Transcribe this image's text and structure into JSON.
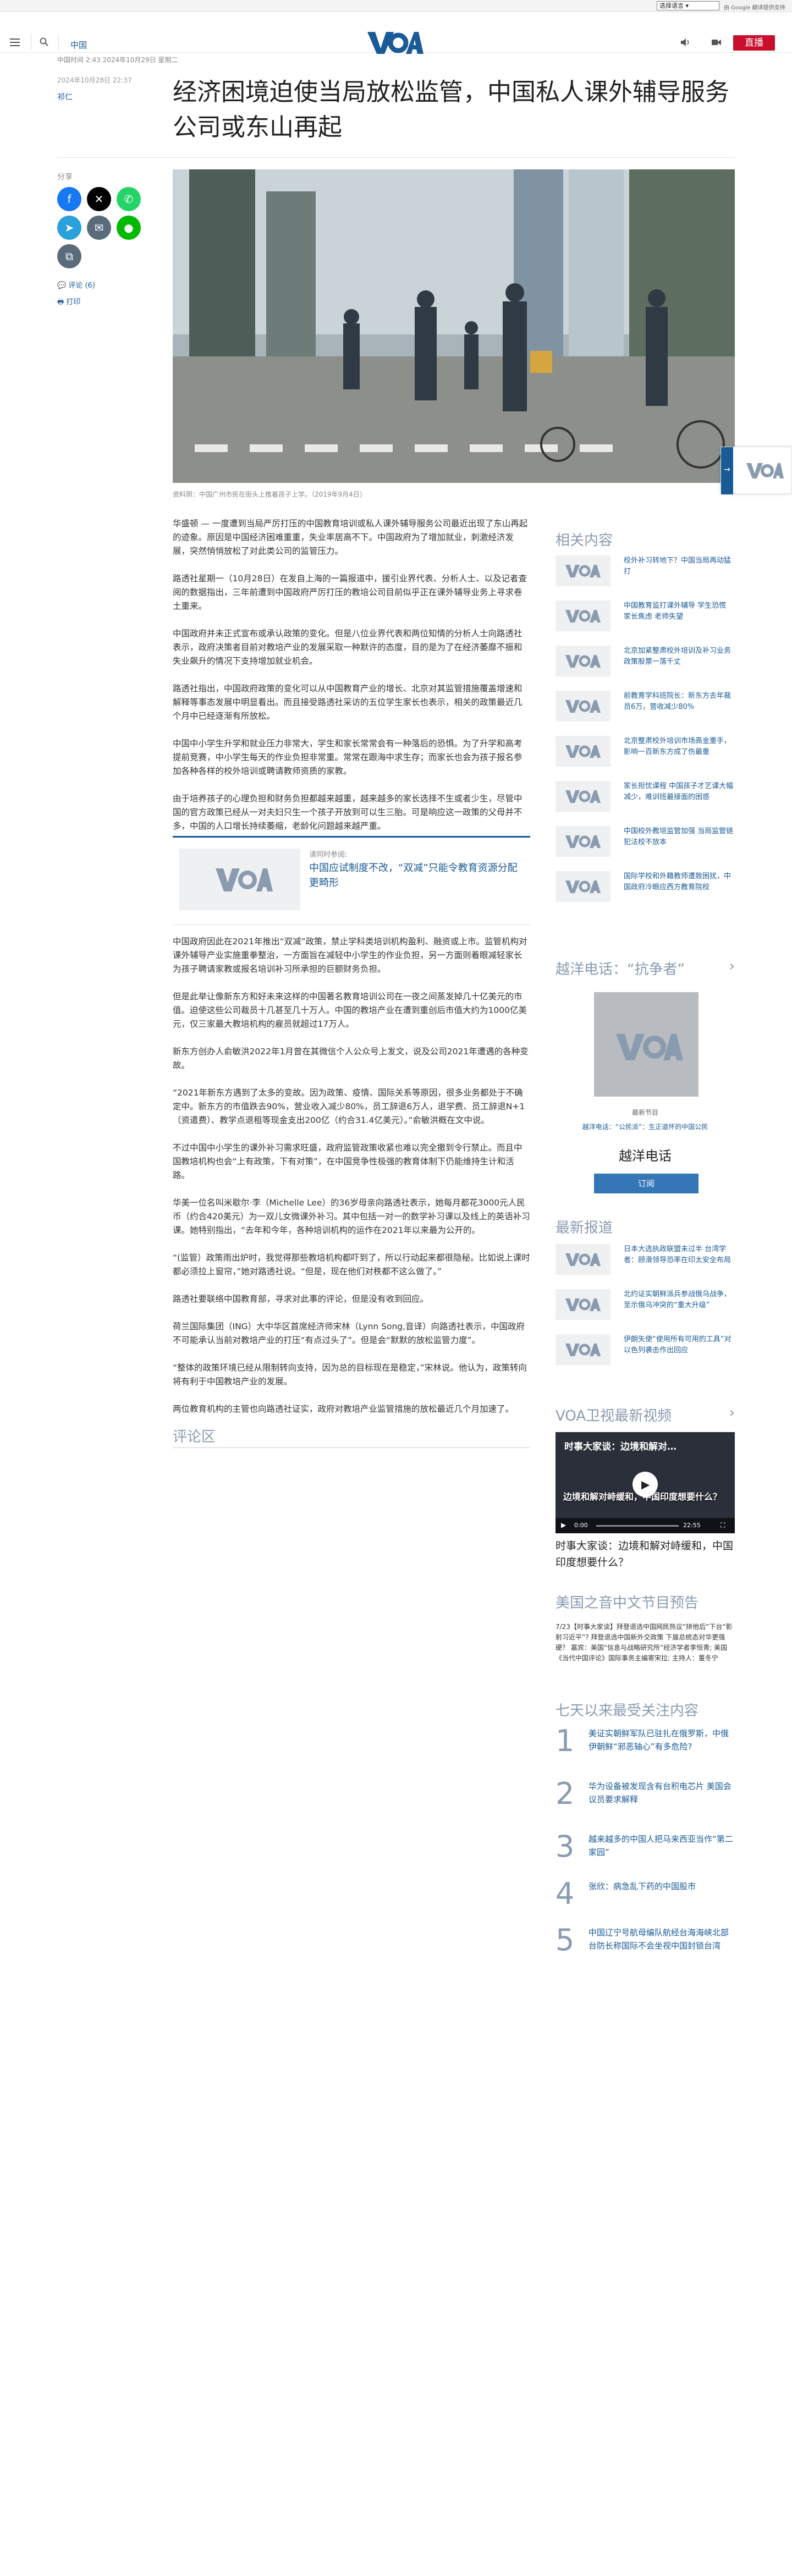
{
  "top_bar": {
    "language_select": "选择语言",
    "translate_brand": "由 Google 翻译提供支持"
  },
  "header": {
    "nav_label": "中国",
    "live_label": "直播"
  },
  "meta": {
    "dateline": "中国时间 2:43 2024年10月29日 星期二",
    "published": "2024年10月28日 22:37",
    "author": "祁仁"
  },
  "article": {
    "title": "经济困境迫使当局放松监管，中国私人课外辅导服务公司或东山再起",
    "image_caption": "资料照：中国广州市民在街头上推着孩子上学。（2019年9月4日）",
    "paragraphs_a": [
      "华盛顿 — 一度遭到当局严厉打压的中国教育培训或私人课外辅导服务公司最近出现了东山再起的迹象。原因是中国经济困难重重，失业率居高不下。中国政府为了增加就业，刺激经济发展，突然悄悄放松了对此类公司的监管压力。",
      "路透社星期一（10月28日）在发自上海的一篇报道中，援引业界代表、分析人士、以及记者查阅的数据指出，三年前遭到中国政府严厉打压的教培公司目前似乎正在课外辅导业务上寻求卷土重来。",
      "中国政府并未正式宣布或承认政策的变化。但是八位业界代表和两位知情的分析人士向路透社表示，政府决策者目前对教培产业的发展采取一种默许的态度，目的是为了在经济萎靡不振和失业飙升的情况下支持增加就业机会。",
      "路透社指出，中国政府政策的变化可以从中国教育产业的增长、北京对其监管措施覆盖增速和解释等事态发展中明显看出。而且接受路透社采访的五位学生家长也表示，相关的政策最近几个月中已经逐渐有所放松。",
      "中国中小学生升学和就业压力非常大，学生和家长常常会有一种落后的恐惧。为了升学和高考提前竞赛，中小学生每天的作业负担非常重。常常在跟海中求生存；而家长也会为孩子报名参加各种各样的校外培训或聘请教师资质的家教。",
      "由于培养孩子的心理负担和财务负担都越来越重，越来越多的家长选择不生或者少生，尽管中国的官方政策已经从一对夫妇只生一个孩子开放到可以生三胎。可是响应这一政策的父母并不多，中国的人口增长持续萎缩，老龄化问题越来越严重。"
    ],
    "related": {
      "label": "请同时参阅:",
      "title": "中国应试制度不改，“双减”只能令教育资源分配更畸形"
    },
    "paragraphs_b": [
      "中国政府因此在2021年推出“双减”政策，禁止学科类培训机构盈利、融资或上市。监管机构对课外辅导产业实施重拳整治，一方面旨在减轻中小学生的作业负担，另一方面则着眼减轻家长为孩子聘请家教或报名培训补习所承担的巨额财务负担。",
      "但是此举让像新东方和好未来这样的中国著名教育培训公司在一夜之间蒸发掉几十亿美元的市值。迫使这些公司裁员十几甚至几十万人。中国的教培产业在遭到重创后市值大约为1000亿美元，仅三家最大教培机构的雇员就超过17万人。",
      "新东方创办人俞敏洪2022年1月曾在其微信个人公众号上发文，说及公司2021年遭遇的各种变故。",
      "“2021年新东方遇到了太多的变故。因为政策、疫情、国际关系等原因，很多业务都处于不确定中。新东方的市值跌去90%，营业收入减少80%，员工辞退6万人，退学费、员工辞退N+1（资遣费）、教学点退租等现金支出200亿（约合31.4亿美元）。”俞敏洪概在文中说。",
      "不过中国中小学生的课外补习需求旺盛，政府监管政策收紧也难以完全撤到令行禁止。而且中国教培机构也会“上有政策，下有对策”，在中国竞争性极强的教育体制下仍能维持生计和活路。",
      "华美一位名叫米歇尔·李（Michelle Lee）的36岁母亲向路透社表示，她每月都花3000元人民币（约合420美元）为一双儿女微课外补习。其中包括一对一的数学补习课以及线上的英语补习课。她特别指出，“去年和今年，各种培训机构的运作在2021年以来最为公开的。",
      "“(监管）政策雨出炉时，我觉得那些教培机构都吓到了，所以行动起来都很隐秘。比如说上课时都必须拉上窗帘，”她对路透社说。“但是，现在他们对秩都不这么做了。”",
      "路透社要联络中国教育部，寻求对此事的评论，但是没有收到回应。",
      "荷兰国际集团（ING）大中华区首席经济师宋林（Lynn Song,音译）向路透社表示，中国政府不可能承认当前对教培产业的打压“有点过头了”。但是会“默默的放松监管力度”。",
      "“整体的政策环境已经从限制转向支持，因为总的目标现在是稳定，”宋林说。他认为，政策转向将有利于中国教培产业的发展。",
      "两位教育机构的主管也向路透社证实，政府对教培产业监管措施的放松最近几个月加速了。"
    ],
    "comments_heading": "评论区"
  },
  "share": {
    "label": "分享",
    "buttons": [
      "facebook",
      "x",
      "whatsapp",
      "telegram",
      "email",
      "line",
      "copy-link"
    ],
    "comments_link": "评论 (6)",
    "print_link": "打印"
  },
  "rail": {
    "related_heading": "相关内容",
    "related_items": [
      "校外补习转地下？中国当局再动猛打",
      "中国教育监打课外辅导 学生恐慌 家长焦虑 老师失望",
      "北京加紧整肃校外培训及补习业务 政策股票一落千丈",
      "前教育学科班院长：新东方去年裁员6万，营收减少80%",
      "北京整肃校外培训市场高金重手，影响一百新东方成了伤最重",
      "家长担忧课程 中国孩子才艺课大幅减少，难训班最接面的困惑",
      "中国校外教培监管加强 当局监管链犯法校不放本",
      "国际学校和外籍教师遭致困扰，中国政府冷眼应西方教育院校"
    ],
    "hotline_heading": "越洋电话：“抗争者”",
    "hotline_kicker": "最新节目",
    "hotline_subtitle": "越洋电话：“公民派”：生正道怀的中国公民",
    "hotline_title": "越洋电话",
    "subscribe_label": "订阅",
    "latest_heading": "最新报道",
    "latest_items": [
      "日本大选执政联盟未过半 台湾学者：顾滑领导恐率在印太安全布局",
      "北约证实朝鲜派兵参战俄乌战争，至示俄乌冲突的“重大升级”",
      "伊朗矢使“使用所有可用的工具”对以色列袭击作出回应"
    ],
    "video_heading": "VOA卫视最新视频",
    "video_overlay": "时事大家谈：边境和解对…",
    "video_banner": "边境和解对峙缓和，中国印度想要什么？",
    "video_time": "0:00",
    "video_duration": "22:55",
    "video_title": "时事大家谈：边境和解对峙缓和，中国印度想要什么？",
    "preview_heading": "美国之音中文节目预告",
    "preview_text": "7/23【时事大家谈】拜登退选中国网民热议“拼他后”下台“影射习近平”? 拜登退选中国新外交政策 下届总统态对华更强硬？ 嘉宾：美国“信息与战略研究所”经济学者李恒青; 美国《当代中国评论》国际事务主编寄宋拉; 主持人：董冬宁",
    "popular_heading": "七天以来最受关注内容",
    "popular_items": [
      {
        "n": "1",
        "t": "美证实朝鲜军队已驻扎在俄罗斯，中俄伊朝鲜“邪恶轴心”有多危险?"
      },
      {
        "n": "2",
        "t": "华为设备被发现含有台积电芯片 美国会议员要求解释"
      },
      {
        "n": "3",
        "t": "越来越多的中国人把马来西亚当作“第二家园”"
      },
      {
        "n": "4",
        "t": "张欣：病急乱下药的中国股市"
      },
      {
        "n": "5",
        "t": "中国辽宁号航母编队航经台海海峡北部 台防长称国际不会坐视中国封锁台湾"
      }
    ]
  }
}
